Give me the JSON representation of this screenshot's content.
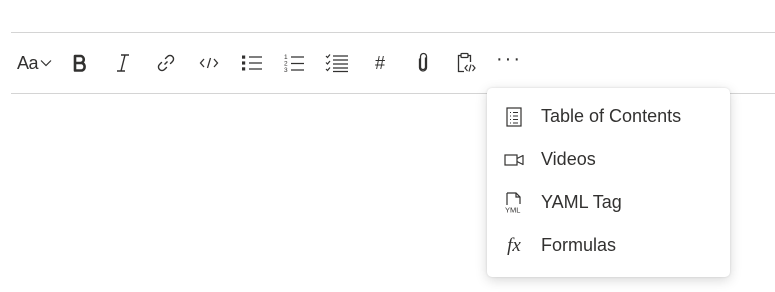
{
  "toolbar": {
    "font_label": "Aa",
    "hash_glyph": "#",
    "more_glyph": "···"
  },
  "menu": {
    "items": [
      {
        "label": "Table of Contents",
        "icon": "table-of-contents-icon"
      },
      {
        "label": "Videos",
        "icon": "video-icon"
      },
      {
        "label": "YAML Tag",
        "icon": "yaml-file-icon",
        "icon_text": "YML"
      },
      {
        "label": "Formulas",
        "icon": "formula-icon",
        "icon_text": "fx"
      }
    ]
  }
}
